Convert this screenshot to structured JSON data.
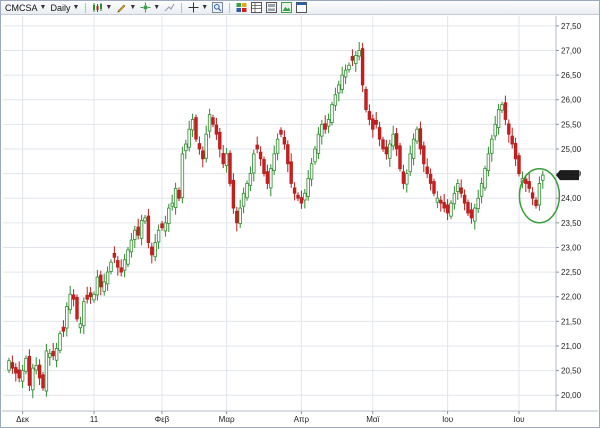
{
  "toolbar": {
    "symbol": "CMCSA",
    "interval": "Daily",
    "icons": [
      "candlestick-icon",
      "draw-pencil-icon",
      "indicator-icon",
      "trendline-icon",
      "crosshair-icon",
      "zoom-icon",
      "compare-icon",
      "table-icon",
      "layout-icon",
      "image-icon",
      "window-icon"
    ]
  },
  "chart_data": {
    "type": "candlestick",
    "y_ticks": [
      "20,00",
      "20,50",
      "21,00",
      "21,50",
      "22,00",
      "22,50",
      "23,00",
      "23,50",
      "24,00",
      "24,50",
      "25,00",
      "25,50",
      "26,00",
      "26,50",
      "27,00",
      "27,50"
    ],
    "x_ticks": [
      {
        "label": "Δεκ",
        "index": 4
      },
      {
        "label": "11",
        "index": 25
      },
      {
        "label": "Φεβ",
        "index": 45
      },
      {
        "label": "Μαρ",
        "index": 64
      },
      {
        "label": "Απρ",
        "index": 86
      },
      {
        "label": "Μαϊ",
        "index": 107
      },
      {
        "label": "Ιου",
        "index": 129
      },
      {
        "label": "Ιου",
        "index": 150
      }
    ],
    "ylim": [
      19.7,
      27.7
    ],
    "last_price": "24,47",
    "colors": {
      "up": "#2e8b2e",
      "up_fill": "#ffffff",
      "down": "#b81d1d",
      "down_fill": "#c8201f",
      "grid": "#e2e6ec",
      "marker": "#3b9c3b",
      "price_tag": "#1c1c1c"
    },
    "highlight_circle": {
      "index": 156,
      "value": 24.05
    },
    "closes": [
      20.7,
      20.55,
      20.45,
      20.35,
      20.5,
      20.75,
      20.2,
      20.55,
      20.6,
      20.35,
      20.15,
      20.9,
      20.85,
      20.8,
      20.95,
      21.25,
      21.3,
      21.8,
      22.05,
      21.95,
      21.55,
      21.45,
      21.9,
      21.95,
      22.0,
      22.05,
      22.4,
      22.2,
      22.3,
      22.5,
      22.7,
      22.8,
      22.6,
      22.5,
      22.75,
      22.95,
      23.15,
      23.35,
      23.25,
      23.55,
      23.6,
      23.1,
      22.85,
      23.1,
      23.35,
      23.4,
      23.5,
      23.8,
      23.9,
      24.2,
      24.0,
      24.9,
      25.1,
      25.4,
      25.6,
      25.2,
      25.0,
      24.8,
      25.3,
      25.7,
      25.5,
      25.3,
      25.0,
      24.7,
      24.9,
      24.3,
      23.8,
      23.5,
      23.8,
      24.1,
      24.3,
      24.5,
      24.9,
      25.0,
      24.8,
      24.5,
      24.3,
      24.6,
      24.9,
      25.2,
      25.3,
      25.1,
      24.7,
      24.3,
      24.1,
      24.0,
      23.9,
      24.1,
      24.4,
      24.7,
      25.0,
      25.3,
      25.5,
      25.4,
      25.6,
      25.9,
      26.1,
      26.3,
      26.5,
      26.6,
      26.7,
      26.8,
      26.9,
      27.0,
      26.3,
      25.8,
      25.6,
      25.4,
      25.5,
      25.2,
      25.0,
      24.9,
      25.1,
      25.3,
      25.0,
      24.6,
      24.3,
      24.5,
      24.9,
      25.2,
      25.4,
      25.0,
      24.7,
      24.5,
      24.3,
      24.1,
      24.0,
      23.9,
      23.8,
      23.7,
      23.9,
      24.1,
      24.3,
      24.1,
      23.9,
      23.7,
      23.6,
      23.8,
      24.0,
      24.3,
      24.6,
      24.9,
      25.2,
      25.5,
      25.8,
      25.9,
      25.6,
      25.3,
      25.1,
      24.8,
      24.5,
      24.4,
      24.3,
      24.2,
      24.0,
      23.85,
      24.3,
      24.47
    ]
  }
}
